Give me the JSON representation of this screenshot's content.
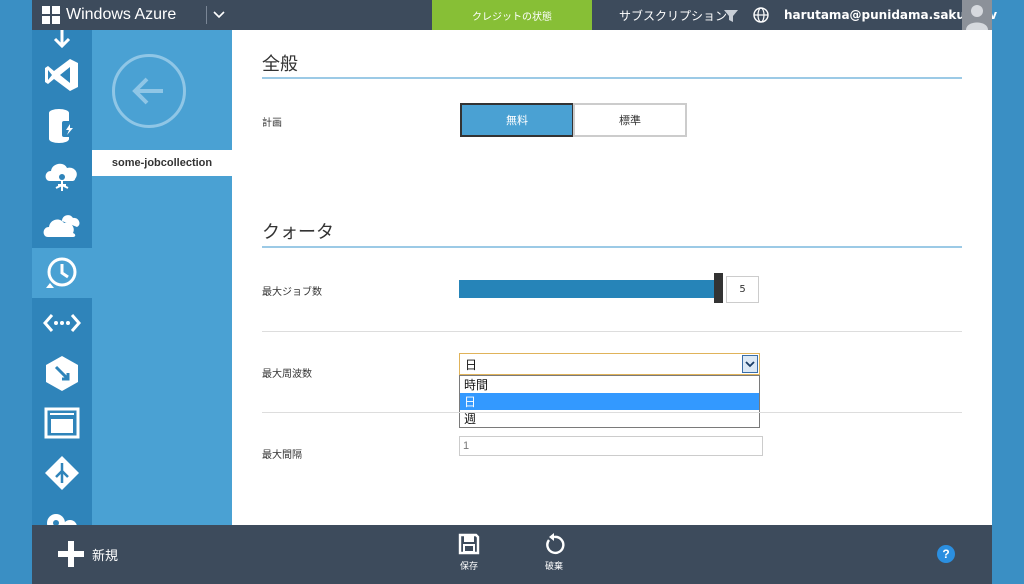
{
  "header": {
    "brand": "Windows Azure",
    "credit_status": "クレジットの状態",
    "subscriptions": "サブスクリプション",
    "user_email": "harutama@punidama.sakura.tv"
  },
  "nav": {
    "selected_item": "some-jobcollection"
  },
  "general": {
    "title": "全般",
    "plan_label": "計画",
    "plan_options": [
      "無料",
      "標準"
    ],
    "plan_selected": "無料"
  },
  "quota": {
    "title": "クォータ",
    "max_jobs_label": "最大ジョブ数",
    "max_jobs_value": "5",
    "max_frequency_label": "最大周波数",
    "frequency_selected": "日",
    "frequency_options": [
      "時間",
      "日",
      "週"
    ],
    "max_interval_label": "最大間隔",
    "max_interval_value": "1"
  },
  "commandbar": {
    "new_label": "新規",
    "save_label": "保存",
    "discard_label": "破棄",
    "help_label": "?"
  },
  "colors": {
    "accent_blue": "#4aa1d3",
    "rail_blue": "#2f84ba",
    "header_dark": "#3d4b5c",
    "credit_green": "#87bf36"
  },
  "rail_icons": [
    "download-icon",
    "visual-studio-icon",
    "storage-icon",
    "hdinsight-icon",
    "cloud-services-icon",
    "scheduler-icon",
    "api-management-icon",
    "mobile-services-icon",
    "media-services-icon",
    "traffic-manager-icon",
    "add-ons-icon"
  ]
}
